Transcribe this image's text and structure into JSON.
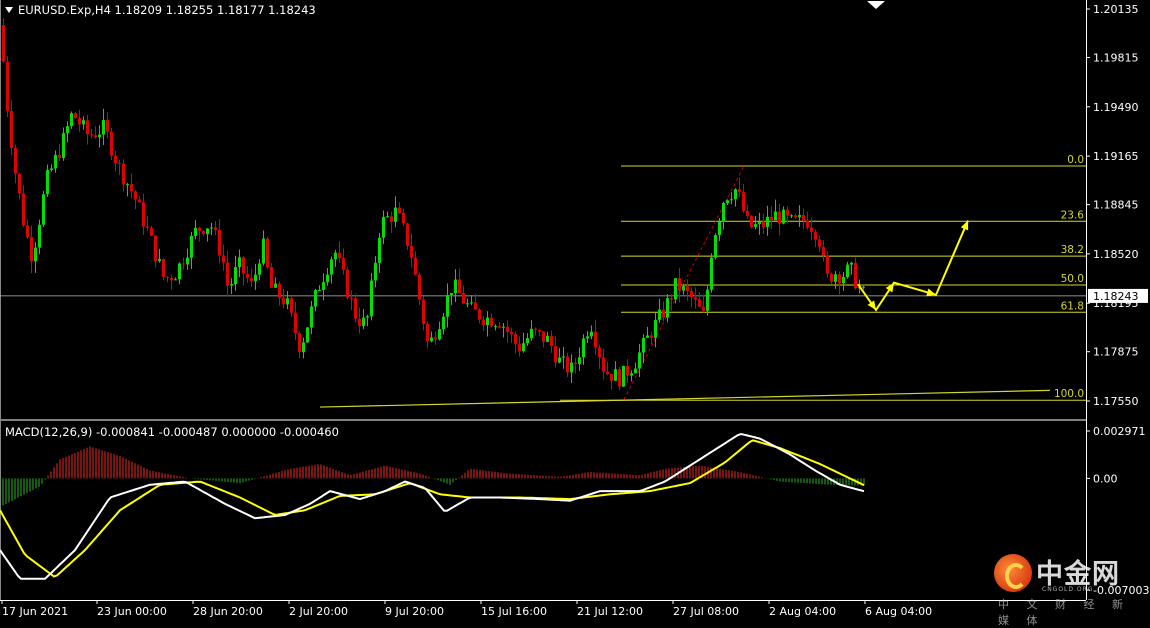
{
  "header": {
    "symbol_line": "EURUSD.Exp,H4  1.18209 1.18255 1.18177 1.18243",
    "macd_line": "MACD(12,26,9) -0.000841 -0.000487 0.000000 -0.000460"
  },
  "watermark": {
    "brand": "中金网",
    "site": "CNGOLD.ORG",
    "tagline": "中 文 财 经 新 媒 体"
  },
  "colors": {
    "background": "#000000",
    "bull_candle": "#00e000",
    "bear_candle": "#e00000",
    "fib": "#d6d62a",
    "arrow": "#ffff00",
    "macd_main": "#ffffff",
    "macd_signal": "#ffff00",
    "axis": "#ffffff",
    "price_line": "#c0c0c0"
  },
  "chart_data": [
    {
      "type": "candlestick",
      "symbol": "EURUSD.Exp",
      "timeframe": "H4",
      "ohlc_current": {
        "open": 1.18209,
        "high": 1.18255,
        "low": 1.18177,
        "close": 1.18243
      },
      "y_ticks": [
        1.20135,
        1.19815,
        1.1949,
        1.19165,
        1.18845,
        1.1852,
        1.18195,
        1.17875,
        1.1755
      ],
      "y_tick_labels": [
        "1.20135",
        "1.19815",
        "1.19490",
        "1.19165",
        "1.18845",
        "1.18520",
        "1.18195",
        "1.17875",
        "1.17550"
      ],
      "ylim": [
        1.1751,
        1.2017
      ],
      "current_price": 1.18243,
      "current_price_label": "1.18243",
      "x_labels": [
        "17 Jun 2021",
        "23 Jun 00:00",
        "28 Jun 20:00",
        "2 Jul 20:00",
        "9 Jul 20:00",
        "15 Jul 16:00",
        "21 Jul 12:00",
        "27 Jul 08:00",
        "2 Aug 04:00",
        "6 Aug 04:00"
      ],
      "fibonacci": {
        "levels": [
          {
            "label": "0.0",
            "price": 1.191
          },
          {
            "label": "23.6",
            "price": 1.18735
          },
          {
            "label": "38.2",
            "price": 1.18505
          },
          {
            "label": "50.0",
            "price": 1.18315
          },
          {
            "label": "61.8",
            "price": 1.18135
          },
          {
            "label": "100.0",
            "price": 1.17555
          }
        ]
      },
      "path_anchors": [
        {
          "t": 0,
          "p": 1.2003
        },
        {
          "t": 6,
          "p": 1.1955
        },
        {
          "t": 14,
          "p": 1.191
        },
        {
          "t": 24,
          "p": 1.187
        },
        {
          "t": 32,
          "p": 1.185
        },
        {
          "t": 46,
          "p": 1.19
        },
        {
          "t": 62,
          "p": 1.1925
        },
        {
          "t": 72,
          "p": 1.1945
        },
        {
          "t": 88,
          "p": 1.193
        },
        {
          "t": 104,
          "p": 1.1935
        },
        {
          "t": 118,
          "p": 1.191
        },
        {
          "t": 134,
          "p": 1.189
        },
        {
          "t": 150,
          "p": 1.1862
        },
        {
          "t": 164,
          "p": 1.1835
        },
        {
          "t": 176,
          "p": 1.184
        },
        {
          "t": 196,
          "p": 1.1868
        },
        {
          "t": 210,
          "p": 1.1872
        },
        {
          "t": 222,
          "p": 1.185
        },
        {
          "t": 228,
          "p": 1.1828
        },
        {
          "t": 238,
          "p": 1.1845
        },
        {
          "t": 252,
          "p": 1.183
        },
        {
          "t": 262,
          "p": 1.186
        },
        {
          "t": 270,
          "p": 1.183
        },
        {
          "t": 286,
          "p": 1.182
        },
        {
          "t": 300,
          "p": 1.179
        },
        {
          "t": 318,
          "p": 1.183
        },
        {
          "t": 334,
          "p": 1.1855
        },
        {
          "t": 346,
          "p": 1.183
        },
        {
          "t": 356,
          "p": 1.181
        },
        {
          "t": 366,
          "p": 1.1805
        },
        {
          "t": 380,
          "p": 1.1872
        },
        {
          "t": 396,
          "p": 1.188
        },
        {
          "t": 410,
          "p": 1.1855
        },
        {
          "t": 428,
          "p": 1.179
        },
        {
          "t": 440,
          "p": 1.181
        },
        {
          "t": 452,
          "p": 1.1832
        },
        {
          "t": 470,
          "p": 1.1815
        },
        {
          "t": 484,
          "p": 1.181
        },
        {
          "t": 500,
          "p": 1.1808
        },
        {
          "t": 518,
          "p": 1.179
        },
        {
          "t": 532,
          "p": 1.18
        },
        {
          "t": 548,
          "p": 1.1795
        },
        {
          "t": 560,
          "p": 1.178
        },
        {
          "t": 572,
          "p": 1.1775
        },
        {
          "t": 590,
          "p": 1.1808
        },
        {
          "t": 604,
          "p": 1.1775
        },
        {
          "t": 620,
          "p": 1.177
        },
        {
          "t": 634,
          "p": 1.178
        },
        {
          "t": 650,
          "p": 1.18
        },
        {
          "t": 664,
          "p": 1.1815
        },
        {
          "t": 676,
          "p": 1.1832
        },
        {
          "t": 692,
          "p": 1.1822
        },
        {
          "t": 704,
          "p": 1.181
        },
        {
          "t": 712,
          "p": 1.186
        },
        {
          "t": 724,
          "p": 1.189
        },
        {
          "t": 736,
          "p": 1.1895
        },
        {
          "t": 748,
          "p": 1.187
        },
        {
          "t": 760,
          "p": 1.187
        },
        {
          "t": 776,
          "p": 1.1878
        },
        {
          "t": 792,
          "p": 1.1872
        },
        {
          "t": 806,
          "p": 1.1875
        },
        {
          "t": 818,
          "p": 1.1865
        },
        {
          "t": 826,
          "p": 1.1835
        },
        {
          "t": 834,
          "p": 1.184
        },
        {
          "t": 842,
          "p": 1.1838
        },
        {
          "t": 850,
          "p": 1.1842
        },
        {
          "t": 858,
          "p": 1.183
        },
        {
          "t": 864,
          "p": 1.18243
        }
      ],
      "forecast_arrows": [
        {
          "t": 858,
          "p": 1.1832
        },
        {
          "t": 876,
          "p": 1.1815
        },
        {
          "t": 894,
          "p": 1.1833
        },
        {
          "t": 936,
          "p": 1.1825
        },
        {
          "t": 968,
          "p": 1.1874
        }
      ],
      "trendline": [
        {
          "t": 320,
          "p": 1.1751
        },
        {
          "t": 1050,
          "p": 1.1762
        }
      ]
    },
    {
      "type": "macd",
      "params": [
        12,
        26,
        9
      ],
      "values": {
        "main": -0.000841,
        "signal": -0.000487,
        "zero": 0.0,
        "histogram": -0.00046
      },
      "y_tick_labels": [
        "0.002971",
        "0.00",
        "-0.007003"
      ],
      "ylim": [
        -0.007003,
        0.002971
      ],
      "main_line": [
        {
          "t": 0,
          "v": -0.0045
        },
        {
          "t": 20,
          "v": -0.0063
        },
        {
          "t": 45,
          "v": -0.0063
        },
        {
          "t": 75,
          "v": -0.0045
        },
        {
          "t": 110,
          "v": -0.0012
        },
        {
          "t": 150,
          "v": -0.0004
        },
        {
          "t": 185,
          "v": -0.0002
        },
        {
          "t": 225,
          "v": -0.0016
        },
        {
          "t": 255,
          "v": -0.0025
        },
        {
          "t": 285,
          "v": -0.0023
        },
        {
          "t": 310,
          "v": -0.0016
        },
        {
          "t": 330,
          "v": -0.0008
        },
        {
          "t": 360,
          "v": -0.0013
        },
        {
          "t": 385,
          "v": -0.0008
        },
        {
          "t": 405,
          "v": -0.0002
        },
        {
          "t": 425,
          "v": -0.0006
        },
        {
          "t": 445,
          "v": -0.0021
        },
        {
          "t": 470,
          "v": -0.0012
        },
        {
          "t": 500,
          "v": -0.0012
        },
        {
          "t": 540,
          "v": -0.0013
        },
        {
          "t": 570,
          "v": -0.0014
        },
        {
          "t": 600,
          "v": -0.0008
        },
        {
          "t": 640,
          "v": -0.0008
        },
        {
          "t": 665,
          "v": -0.0002
        },
        {
          "t": 690,
          "v": 0.0008
        },
        {
          "t": 715,
          "v": 0.0018
        },
        {
          "t": 740,
          "v": 0.0028
        },
        {
          "t": 760,
          "v": 0.0025
        },
        {
          "t": 790,
          "v": 0.0015
        },
        {
          "t": 815,
          "v": 0.0005
        },
        {
          "t": 840,
          "v": -0.0004
        },
        {
          "t": 866,
          "v": -0.000841
        }
      ],
      "signal_line": [
        {
          "t": 0,
          "v": -0.002
        },
        {
          "t": 25,
          "v": -0.0048
        },
        {
          "t": 55,
          "v": -0.0062
        },
        {
          "t": 85,
          "v": -0.0045
        },
        {
          "t": 120,
          "v": -0.002
        },
        {
          "t": 160,
          "v": -0.0004
        },
        {
          "t": 200,
          "v": -0.0002
        },
        {
          "t": 240,
          "v": -0.0012
        },
        {
          "t": 275,
          "v": -0.0023
        },
        {
          "t": 305,
          "v": -0.002
        },
        {
          "t": 340,
          "v": -0.0011
        },
        {
          "t": 375,
          "v": -0.001
        },
        {
          "t": 410,
          "v": -0.0003
        },
        {
          "t": 440,
          "v": -0.001
        },
        {
          "t": 470,
          "v": -0.0012
        },
        {
          "t": 520,
          "v": -0.0012
        },
        {
          "t": 570,
          "v": -0.0013
        },
        {
          "t": 610,
          "v": -0.001
        },
        {
          "t": 650,
          "v": -0.0008
        },
        {
          "t": 690,
          "v": -0.0003
        },
        {
          "t": 725,
          "v": 0.001
        },
        {
          "t": 752,
          "v": 0.0024
        },
        {
          "t": 780,
          "v": 0.0019
        },
        {
          "t": 820,
          "v": 0.0009
        },
        {
          "t": 866,
          "v": -0.000487
        }
      ],
      "histogram_profile": [
        {
          "t": 0,
          "v": -0.0018
        },
        {
          "t": 40,
          "v": -0.0005
        },
        {
          "t": 60,
          "v": 0.0012
        },
        {
          "t": 90,
          "v": 0.002
        },
        {
          "t": 120,
          "v": 0.0014
        },
        {
          "t": 150,
          "v": 0.0005
        },
        {
          "t": 190,
          "v": 0.0
        },
        {
          "t": 240,
          "v": -0.0003
        },
        {
          "t": 290,
          "v": 0.0006
        },
        {
          "t": 320,
          "v": 0.0009
        },
        {
          "t": 350,
          "v": 0.0002
        },
        {
          "t": 385,
          "v": 0.0008
        },
        {
          "t": 420,
          "v": 0.0003
        },
        {
          "t": 450,
          "v": -0.0004
        },
        {
          "t": 470,
          "v": 0.0006
        },
        {
          "t": 510,
          "v": 0.0003
        },
        {
          "t": 560,
          "v": 0.0001
        },
        {
          "t": 590,
          "v": 0.0004
        },
        {
          "t": 640,
          "v": 0.0002
        },
        {
          "t": 665,
          "v": 0.0006
        },
        {
          "t": 700,
          "v": 0.0008
        },
        {
          "t": 740,
          "v": 0.0004
        },
        {
          "t": 780,
          "v": -0.0002
        },
        {
          "t": 830,
          "v": -0.0004
        },
        {
          "t": 866,
          "v": -0.00046
        }
      ]
    }
  ]
}
